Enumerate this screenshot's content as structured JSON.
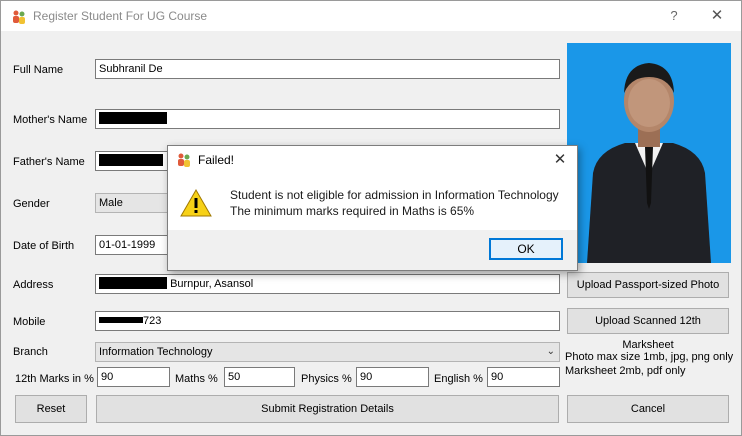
{
  "window": {
    "title": "Register Student For UG Course",
    "help_symbol": "?",
    "close_symbol": "✕",
    "app_icon": "people-icon"
  },
  "form": {
    "full_name": {
      "label": "Full Name",
      "value": "Subhranil De"
    },
    "mothers_name": {
      "label": "Mother's Name",
      "value": ""
    },
    "fathers_name": {
      "label": "Father's Name",
      "value": ""
    },
    "gender": {
      "label": "Gender",
      "value": "Male"
    },
    "dob": {
      "label": "Date of Birth",
      "value": "01-01-1999"
    },
    "address": {
      "label": "Address",
      "value": "Burnpur, Asansol"
    },
    "mobile": {
      "label": "Mobile",
      "value": "723"
    },
    "branch": {
      "label": "Branch",
      "value": "Information Technology"
    },
    "marks": {
      "twelfth_label": "12th Marks in %",
      "twelfth_value": "90",
      "maths_label": "Maths %",
      "maths_value": "50",
      "physics_label": "Physics %",
      "physics_value": "90",
      "english_label": "English %",
      "english_value": "90"
    }
  },
  "buttons": {
    "upload_photo": "Upload Passport-sized Photo",
    "upload_marksheet": "Upload Scanned 12th Marksheet",
    "reset": "Reset",
    "submit": "Submit Registration Details",
    "cancel": "Cancel"
  },
  "notes": {
    "line1": "Photo max size 1mb, jpg, png only",
    "line2": "Marksheet 2mb, pdf only"
  },
  "dialog": {
    "title": "Failed!",
    "close_symbol": "✕",
    "message_line1": "Student is not eligible for admission in Information Technology",
    "message_line2": "The minimum marks required in Maths is 65%",
    "ok_label": "OK",
    "icon": "warning-icon"
  },
  "colors": {
    "photo_background": "#1a97e8",
    "dialog_focus": "#0078d7",
    "warning_yellow": "#f7d117"
  }
}
